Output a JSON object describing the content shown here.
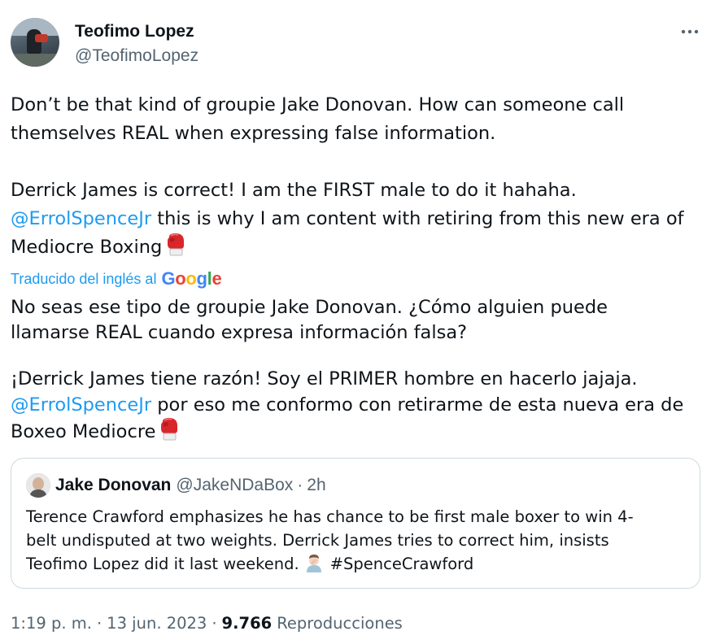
{
  "author": {
    "display_name": "Teofimo Lopez",
    "handle": "@TeofimoLopez"
  },
  "more_icon": "ellipsis-horizontal-icon",
  "tweet": {
    "paragraph1": [
      "Don’t be that kind of groupie Jake Donovan. How can someone call",
      "themselves REAL when expressing false information."
    ],
    "paragraph2_line1": "Derrick James is correct! I am the FIRST male to do it hahaha.",
    "paragraph2_mention": "@ErrolSpenceJr",
    "paragraph2_line2_rest": " this is why I am content with retiring from this new era of",
    "paragraph2_line3": "Mediocre Boxing",
    "emoji": "boxing-glove-icon"
  },
  "translation": {
    "label": "Traducido del inglés al",
    "provider": "Google",
    "provider_colors": [
      "#4285F4",
      "#EA4335",
      "#FBBC05",
      "#4285F4",
      "#34A853",
      "#EA4335"
    ],
    "paragraph1": [
      "No seas ese tipo de groupie Jake Donovan. ¿Cómo alguien puede",
      "llamarse REAL cuando expresa información falsa?"
    ],
    "paragraph2_line1": "¡Derrick James tiene razón! Soy el PRIMER hombre en hacerlo jajaja.",
    "paragraph2_mention": "@ErrolSpenceJr",
    "paragraph2_line2_rest": " por eso me conformo con retirarme de esta nueva era de",
    "paragraph2_line3": "Boxeo Mediocre"
  },
  "quoted": {
    "display_name": "Jake Donovan",
    "handle": "@JakeNDaBox",
    "separator": "·",
    "time": "2h",
    "lines": [
      "Terence Crawford emphasizes he has chance to be first male boxer to win 4-",
      "belt undisputed at two weights. Derrick James tries to correct him, insists"
    ],
    "line3_text": "Teofimo Lopez did it last weekend.",
    "line3_emoji": "man-facepalming-icon",
    "hashtag": "#SpenceCrawford"
  },
  "meta": {
    "time": "1:19 p. m.",
    "separator": "·",
    "date": "13 jun. 2023",
    "views_count": "9.766",
    "views_label": "Reproducciones"
  },
  "colors": {
    "link": "#1d9bf0",
    "secondary_text": "#536471",
    "primary_text": "#0f1419",
    "border": "#cfd9de"
  }
}
